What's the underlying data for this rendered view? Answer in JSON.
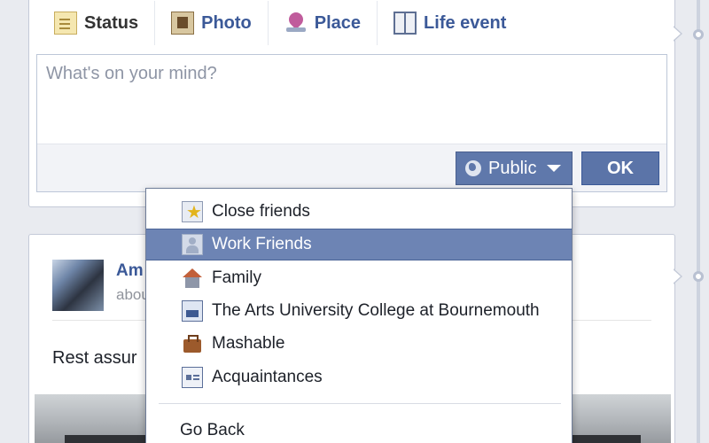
{
  "composer": {
    "tabs": [
      {
        "label": "Status",
        "icon": "status-icon"
      },
      {
        "label": "Photo",
        "icon": "photo-icon"
      },
      {
        "label": "Place",
        "icon": "place-icon"
      },
      {
        "label": "Life event",
        "icon": "life-event-icon"
      }
    ],
    "placeholder": "What's on your mind?",
    "privacy_label": "Public",
    "ok_label": "OK"
  },
  "post": {
    "author_partial": "Am",
    "subtitle_partial": "abou",
    "text_partial": "Rest assur"
  },
  "audience_menu": {
    "items": [
      {
        "label": "Close friends",
        "icon": "star-list-icon"
      },
      {
        "label": "Work Friends",
        "icon": "work-list-icon",
        "selected": true
      },
      {
        "label": "Family",
        "icon": "home-icon"
      },
      {
        "label": "The Arts University College at Bournemouth",
        "icon": "school-icon"
      },
      {
        "label": "Mashable",
        "icon": "briefcase-icon"
      },
      {
        "label": "Acquaintances",
        "icon": "contact-card-icon"
      }
    ],
    "go_back_label": "Go Back"
  },
  "colors": {
    "brand_blue": "#3b5998",
    "selected_row": "#6d84b4",
    "background": "#e9ebf0"
  }
}
